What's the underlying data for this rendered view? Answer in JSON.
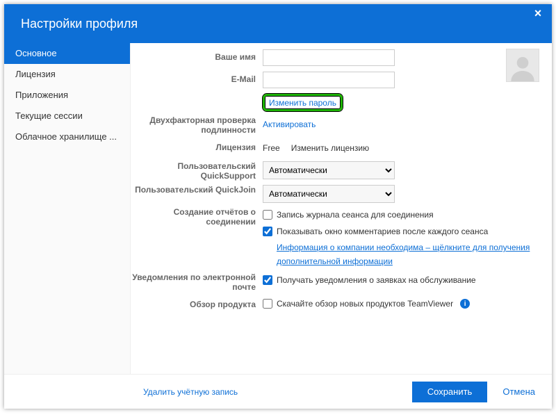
{
  "title": "Настройки профиля",
  "sidebar": {
    "items": [
      {
        "label": "Основное",
        "active": true
      },
      {
        "label": "Лицензия"
      },
      {
        "label": "Приложения"
      },
      {
        "label": "Текущие сессии"
      },
      {
        "label": "Облачное хранилище ..."
      }
    ]
  },
  "labels": {
    "name": "Ваше имя",
    "email": "E-Mail",
    "twofa": "Двухфакторная проверка подлинности",
    "license": "Лицензия",
    "quicksupport": "Пользовательский QuickSupport",
    "quickjoin": "Пользовательский QuickJoin",
    "reports": "Создание отчётов о соединении",
    "emailnotif": "Уведомления по электронной почте",
    "overview": "Обзор продукта"
  },
  "values": {
    "name": " ",
    "email": "                       ",
    "changePassword": "Изменить пароль",
    "activate": "Активировать",
    "licenseValue": "Free",
    "changeLicense": "Изменить лицензию",
    "auto": "Автоматически",
    "logRecord": "Запись журнала сеанса для соединения",
    "showComments": "Показывать окно комментариев после каждого сеанса",
    "companyInfo": "Информация о компании необходима – щёлкните для получения дополнительной информации",
    "receiveNotif": "Получать уведомления о заявках на обслуживание",
    "downloadOverview": "Скачайте обзор новых продуктов TeamViewer"
  },
  "footer": {
    "deleteAccount": "Удалить учётную запись",
    "save": "Сохранить",
    "cancel": "Отмена"
  }
}
